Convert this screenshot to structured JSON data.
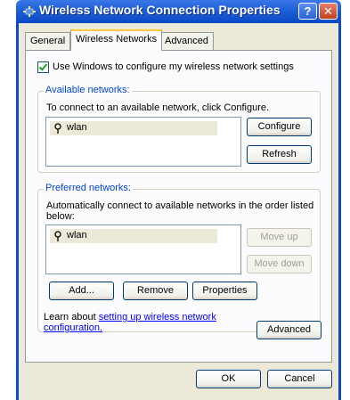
{
  "window": {
    "title": "Wireless Network Connection Properties",
    "help_label": "?",
    "close_label": "✕"
  },
  "tabs": [
    {
      "label": "General",
      "active": false
    },
    {
      "label": "Wireless Networks",
      "active": true
    },
    {
      "label": "Advanced",
      "active": false
    }
  ],
  "use_windows_checkbox": {
    "label": "Use Windows to configure my wireless network settings",
    "checked": true
  },
  "available": {
    "legend": "Available networks:",
    "description": "To connect to an available network, click Configure.",
    "networks": [
      {
        "name": "wlan"
      }
    ],
    "configure_label": "Configure",
    "refresh_label": "Refresh"
  },
  "preferred": {
    "legend": "Preferred networks:",
    "description_line1": "Automatically connect to available networks in the order listed",
    "description_line2": "below:",
    "networks": [
      {
        "name": "wlan"
      }
    ],
    "move_up_label": "Move up",
    "move_down_label": "Move down",
    "add_label": "Add...",
    "remove_label": "Remove",
    "properties_label": "Properties"
  },
  "learn": {
    "prefix": "Learn about ",
    "link_line1": "setting up wireless network",
    "link_line2": "configuration."
  },
  "advanced_button_label": "Advanced",
  "ok_label": "OK",
  "cancel_label": "Cancel"
}
